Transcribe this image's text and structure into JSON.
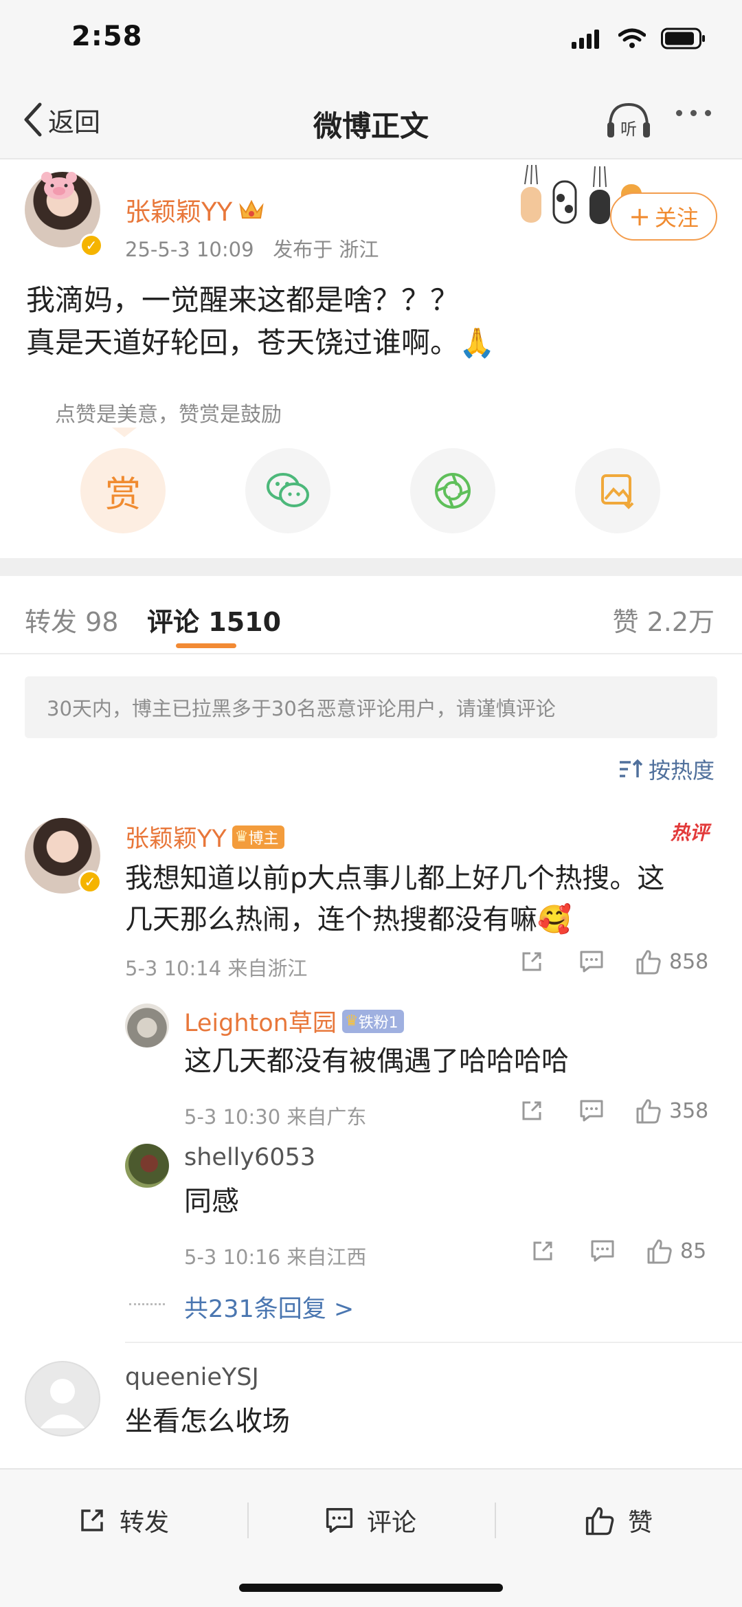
{
  "status_bar": {
    "time": "2:58"
  },
  "nav": {
    "back_label": "返回",
    "title": "微博正文",
    "listen_label": "听"
  },
  "post": {
    "author": "张颖颖YY",
    "date": "25-5-3 10:09",
    "location": "发布于 浙江",
    "follow_label": "关注",
    "body_line1": "我滴妈，一觉醒来这都是啥？？？",
    "body_line2": "真是天道好轮回，苍天饶过谁啊。🙏",
    "reward_hint": "点赞是美意，赞赏是鼓励",
    "reward_label": "赏"
  },
  "tabs": {
    "repost_label": "转发",
    "repost_count": "98",
    "comment_label": "评论",
    "comment_count": "1510",
    "like_label": "赞",
    "like_count": "2.2万"
  },
  "notice": "30天内，博主已拉黑多于30名恶意评论用户，请谨慎评论",
  "sort_label": "按热度",
  "comments": [
    {
      "name": "张颖颖YY",
      "tag": "博主",
      "hot_badge": "热评",
      "text_line1": "我想知道以前p大点事儿都上好几个热搜。这",
      "text_line2": "几天那么热闹，连个热搜都没有嘛🥰",
      "meta": "5-3 10:14  来自浙江",
      "likes": "858",
      "replies": [
        {
          "name": "Leighton草园",
          "tag": "铁粉1",
          "text": "这几天都没有被偶遇了哈哈哈哈",
          "meta": "5-3 10:30  来自广东",
          "likes": "358"
        },
        {
          "name": "shelly6053",
          "text": "同感",
          "meta": "5-3 10:16  来自江西",
          "likes": "85"
        }
      ],
      "more_replies": "共231条回复 >"
    },
    {
      "name": "queenieYSJ",
      "text": "坐看怎么收场"
    }
  ],
  "bottom_bar": {
    "repost": "转发",
    "comment": "评论",
    "like": "赞"
  },
  "colors": {
    "accent": "#f08b30",
    "name": "#e8773a",
    "link": "#4a76b0"
  }
}
